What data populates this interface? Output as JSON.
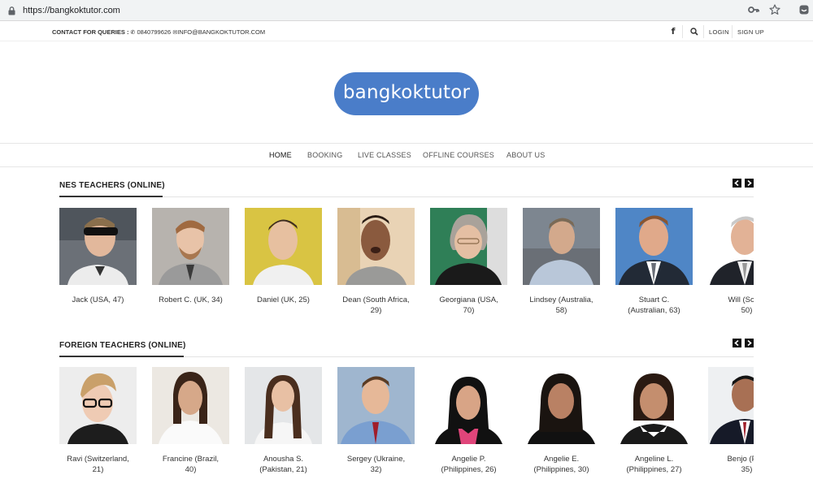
{
  "browser": {
    "url": "https://bangkoktutor.com"
  },
  "topbar": {
    "contact_label": "CONTACT FOR QUERIES :",
    "phone": "0840799626",
    "email": "INFO@BANGKOKTUTOR.COM",
    "login": "LOGIN",
    "signup": "SIGN UP"
  },
  "logo": {
    "text": "bangkoktutor"
  },
  "nav": {
    "items": [
      "HOME",
      "BOOKING",
      "LIVE CLASSES",
      "OFFLINE COURSES",
      "ABOUT US"
    ]
  },
  "sections": [
    {
      "title": "NES TEACHERS (ONLINE)",
      "teachers": [
        {
          "line1": "Jack (USA, 47)",
          "line2": ""
        },
        {
          "line1": "Robert C. (UK, 34)",
          "line2": ""
        },
        {
          "line1": "Daniel (UK, 25)",
          "line2": ""
        },
        {
          "line1": "Dean (South Africa,",
          "line2": "29)"
        },
        {
          "line1": "Georgiana (USA,",
          "line2": "70)"
        },
        {
          "line1": "Lindsey (Australia,",
          "line2": "58)"
        },
        {
          "line1": "Stuart C.",
          "line2": "(Australian, 63)"
        },
        {
          "line1": "Will (South",
          "line2": "50)"
        }
      ]
    },
    {
      "title": "FOREIGN TEACHERS (ONLINE)",
      "teachers": [
        {
          "line1": "Ravi (Switzerland,",
          "line2": "21)"
        },
        {
          "line1": "Francine (Brazil,",
          "line2": "40)"
        },
        {
          "line1": "Anousha S.",
          "line2": "(Pakistan, 21)"
        },
        {
          "line1": "Sergey (Ukraine,",
          "line2": "32)"
        },
        {
          "line1": "Angelie P.",
          "line2": "(Philippines, 26)"
        },
        {
          "line1": "Angelie E.",
          "line2": "(Philippines, 30)"
        },
        {
          "line1": "Angeline L.",
          "line2": "(Philippines, 27)"
        },
        {
          "line1": "Benjo (Phili",
          "line2": "35)"
        }
      ]
    }
  ],
  "colors": {
    "logo_bg": "#4a7dc9",
    "arrow_bg": "#111111"
  }
}
